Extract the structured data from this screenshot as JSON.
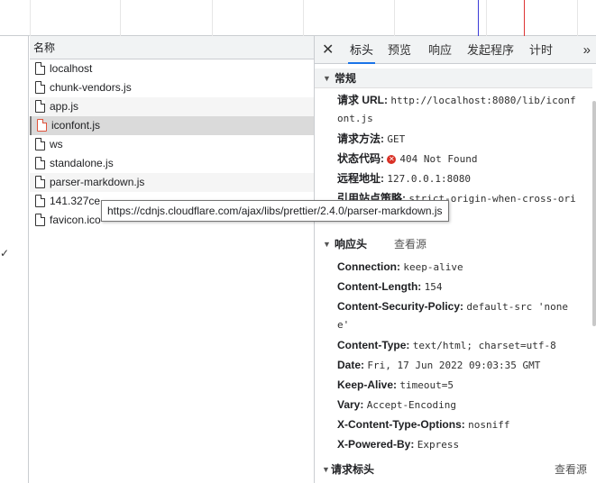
{
  "request_list": {
    "column_header": "名称",
    "rows": [
      {
        "name": "localhost"
      },
      {
        "name": "chunk-vendors.js"
      },
      {
        "name": "app.js"
      },
      {
        "name": "iconfont.js"
      },
      {
        "name": "ws"
      },
      {
        "name": "standalone.js"
      },
      {
        "name": "parser-markdown.js"
      },
      {
        "name": "141.327ce"
      },
      {
        "name": "favicon.ico"
      }
    ],
    "selected_row": "iconfont.js"
  },
  "left_sliver": {
    "check_glyph": "✓"
  },
  "tooltip": {
    "text": "https://cdnjs.cloudflare.com/ajax/libs/prettier/2.4.0/parser-markdown.js"
  },
  "tabs": {
    "close_glyph": "✕",
    "items": [
      "标头",
      "预览",
      "响应",
      "发起程序",
      "计时"
    ],
    "active": "标头",
    "more_glyph": "»"
  },
  "general": {
    "title": "常规",
    "request_url_label": "请求 URL:",
    "request_url_value_1": "http://localhost:8080/lib/iconf",
    "request_url_value_2": "ont.js",
    "method_label": "请求方法:",
    "method_value": "GET",
    "status_label": "状态代码:",
    "status_icon": "error-icon",
    "status_value": "404 Not Found",
    "remote_label": "远程地址:",
    "remote_value": "127.0.0.1:8080",
    "referrer_label": "引用站点策略:",
    "referrer_value": "strict-origin-when-cross-ori",
    "referrer_value_2": "g"
  },
  "response_headers": {
    "title": "响应头",
    "view_source": "查看源",
    "items": [
      {
        "key": "Connection:",
        "value": "keep-alive"
      },
      {
        "key": "Content-Length:",
        "value": "154"
      },
      {
        "key": "Content-Security-Policy:",
        "value": "default-src 'none"
      },
      {
        "key": "",
        "value": "e'"
      },
      {
        "key": "Content-Type:",
        "value": "text/html; charset=utf-8"
      },
      {
        "key": "Date:",
        "value": "Fri, 17 Jun 2022 09:03:35 GMT"
      },
      {
        "key": "Keep-Alive:",
        "value": "timeout=5"
      },
      {
        "key": "Vary:",
        "value": "Accept-Encoding"
      },
      {
        "key": "X-Content-Type-Options:",
        "value": "nosniff"
      },
      {
        "key": "X-Powered-By:",
        "value": "Express"
      }
    ]
  },
  "request_headers": {
    "title": "请求标头",
    "view_source": "查看源"
  }
}
